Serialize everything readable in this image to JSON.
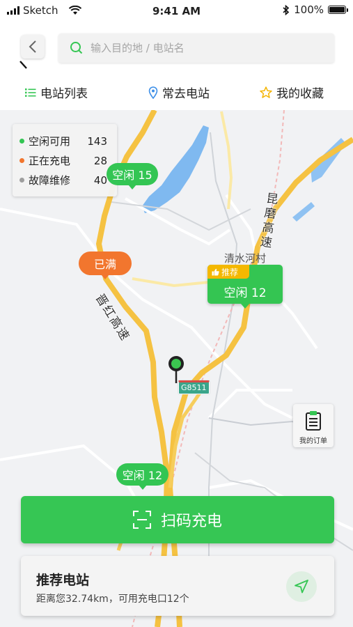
{
  "status_bar": {
    "carrier": "Sketch",
    "time": "9:41 AM",
    "battery": "100%"
  },
  "search": {
    "placeholder": "输入目的地 / 电站名"
  },
  "tabs": [
    {
      "label": "电站列表",
      "icon": "list-icon"
    },
    {
      "label": "常去电站",
      "icon": "location-pin-icon"
    },
    {
      "label": "我的收藏",
      "icon": "star-icon"
    }
  ],
  "legend": [
    {
      "label": "空闲可用",
      "count": "143",
      "color": "#33c553"
    },
    {
      "label": "正在充电",
      "count": "28",
      "color": "#f2762e"
    },
    {
      "label": "故障维修",
      "count": "40",
      "color": "#9e9e9e"
    }
  ],
  "map_labels": {
    "expressway_1": "昆磨高速",
    "expressway_2": "晋红高速",
    "village": "清水河村",
    "highway_shield": "G8511"
  },
  "markers": {
    "idle_15": "空闲 15",
    "full": "已满",
    "recommend_tag": "推荐",
    "recommend_label": "空闲 12",
    "idle_12": "空闲 12"
  },
  "orders_button": {
    "label": "我的订单"
  },
  "scan_button": {
    "label": "扫码充电"
  },
  "recommend_card": {
    "title": "推荐电站",
    "desc": "距离您32.74km，可用充电口12个"
  },
  "colors": {
    "accent": "#36c654",
    "orange": "#f2762e",
    "road_yellow": "#f5c242",
    "water": "#7fb9f0"
  }
}
